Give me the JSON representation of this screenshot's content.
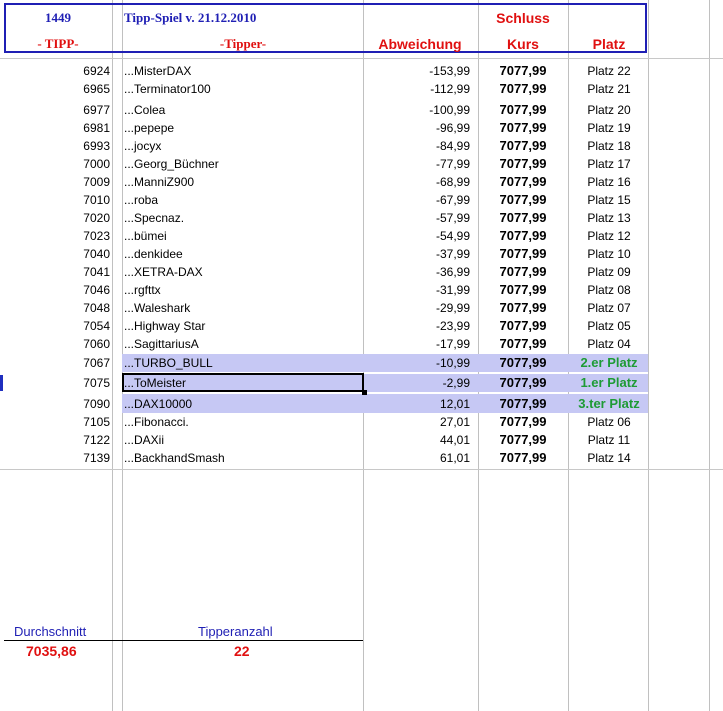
{
  "header": {
    "id": "1449",
    "title": "Tipp-Spiel v. 21.12.2010",
    "schluss": "Schluss",
    "col_tipp": "- TIPP-",
    "col_tipper": "-Tipper-",
    "col_abweichung": "Abweichung",
    "col_kurs": "Kurs",
    "col_platz": "Platz"
  },
  "rows": [
    {
      "tipp": "6924",
      "name": "...MisterDAX",
      "abw": "-153,99",
      "kurs": "7077,99",
      "platz": "Platz 22"
    },
    {
      "tipp": "6965",
      "name": "...Terminator100",
      "abw": "-112,99",
      "kurs": "7077,99",
      "platz": "Platz 21"
    },
    {
      "tipp": "6977",
      "name": "...Colea",
      "abw": "-100,99",
      "kurs": "7077,99",
      "platz": "Platz 20"
    },
    {
      "tipp": "6981",
      "name": "...pepepe",
      "abw": "-96,99",
      "kurs": "7077,99",
      "platz": "Platz 19"
    },
    {
      "tipp": "6993",
      "name": "...jocyx",
      "abw": "-84,99",
      "kurs": "7077,99",
      "platz": "Platz 18"
    },
    {
      "tipp": "7000",
      "name": "...Georg_Büchner",
      "abw": "-77,99",
      "kurs": "7077,99",
      "platz": "Platz 17"
    },
    {
      "tipp": "7009",
      "name": "...ManniZ900",
      "abw": "-68,99",
      "kurs": "7077,99",
      "platz": "Platz 16"
    },
    {
      "tipp": "7010",
      "name": "...roba",
      "abw": "-67,99",
      "kurs": "7077,99",
      "platz": "Platz 15"
    },
    {
      "tipp": "7020",
      "name": "...Specnaz.",
      "abw": "-57,99",
      "kurs": "7077,99",
      "platz": "Platz 13"
    },
    {
      "tipp": "7023",
      "name": "...bümei",
      "abw": "-54,99",
      "kurs": "7077,99",
      "platz": "Platz 12"
    },
    {
      "tipp": "7040",
      "name": "...denkidee",
      "abw": "-37,99",
      "kurs": "7077,99",
      "platz": "Platz 10"
    },
    {
      "tipp": "7041",
      "name": "...XETRA-DAX",
      "abw": "-36,99",
      "kurs": "7077,99",
      "platz": "Platz 09"
    },
    {
      "tipp": "7046",
      "name": "...rgfttx",
      "abw": "-31,99",
      "kurs": "7077,99",
      "platz": "Platz 08"
    },
    {
      "tipp": "7048",
      "name": "...Waleshark",
      "abw": "-29,99",
      "kurs": "7077,99",
      "platz": "Platz 07"
    },
    {
      "tipp": "7054",
      "name": "...Highway Star",
      "abw": "-23,99",
      "kurs": "7077,99",
      "platz": "Platz 05"
    },
    {
      "tipp": "7060",
      "name": "...SagittariusA",
      "abw": "-17,99",
      "kurs": "7077,99",
      "platz": "Platz 04"
    },
    {
      "tipp": "7067",
      "name": "...TURBO_BULL",
      "abw": "-10,99",
      "kurs": "7077,99",
      "platz": "2.er Platz"
    },
    {
      "tipp": "7075",
      "name": "...ToMeister",
      "abw": "-2,99",
      "kurs": "7077,99",
      "platz": "1.er Platz"
    },
    {
      "tipp": "7090",
      "name": "...DAX10000",
      "abw": "12,01",
      "kurs": "7077,99",
      "platz": "3.ter Platz"
    },
    {
      "tipp": "7105",
      "name": "...Fibonacci.",
      "abw": "27,01",
      "kurs": "7077,99",
      "platz": "Platz 06"
    },
    {
      "tipp": "7122",
      "name": "...DAXii",
      "abw": "44,01",
      "kurs": "7077,99",
      "platz": "Platz 11"
    },
    {
      "tipp": "7139",
      "name": "...BackhandSmash",
      "abw": "61,01",
      "kurs": "7077,99",
      "platz": "Platz 14"
    }
  ],
  "footer": {
    "durchschnitt_label": "Durchschnitt",
    "durchschnitt_value": "7035,86",
    "tipperanzahl_label": "Tipperanzahl",
    "tipperanzahl_value": "22"
  },
  "colors": {
    "highlight": "#c6c8f4",
    "header_blue": "#1f1fb4",
    "header_red": "#e01010",
    "winner_green": "#1e9b35"
  }
}
